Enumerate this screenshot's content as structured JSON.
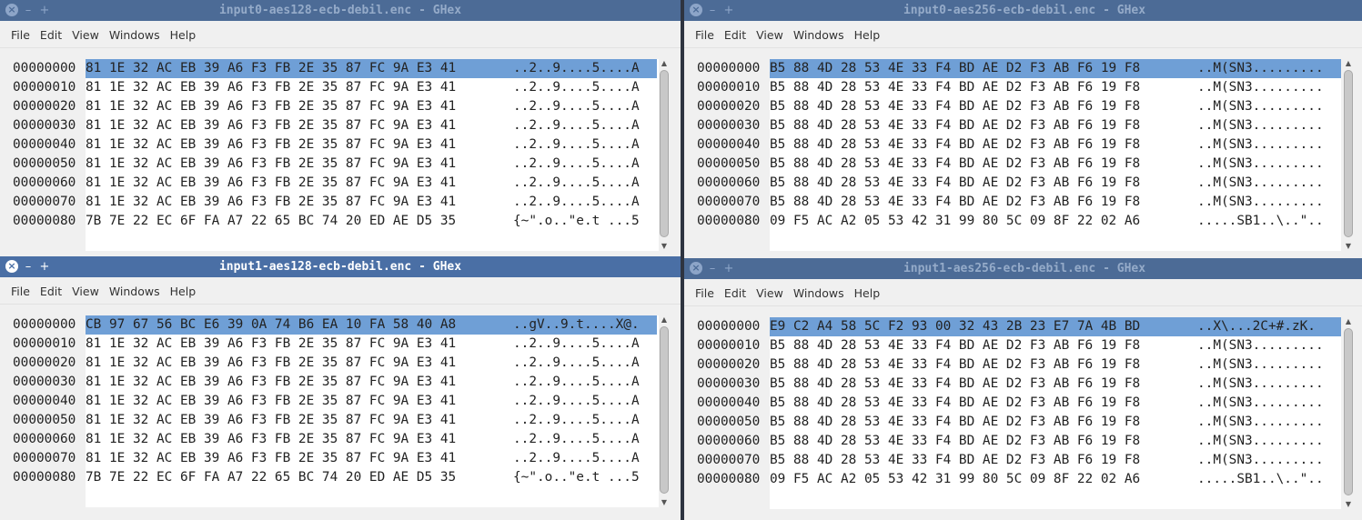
{
  "menus": [
    "File",
    "Edit",
    "View",
    "Windows",
    "Help"
  ],
  "controls": {
    "close": "×",
    "minimize": "–",
    "maximize": "+"
  },
  "scroll": {
    "up": "▲",
    "down": "▼"
  },
  "windows": [
    {
      "title": "input0-aes128-ecb-debil.enc - GHex",
      "active": false,
      "offsets": [
        "00000000",
        "00000010",
        "00000020",
        "00000030",
        "00000040",
        "00000050",
        "00000060",
        "00000070",
        "00000080"
      ],
      "hex": [
        "81 1E 32 AC EB 39 A6 F3 FB 2E 35 87 FC 9A E3 41",
        "81 1E 32 AC EB 39 A6 F3 FB 2E 35 87 FC 9A E3 41",
        "81 1E 32 AC EB 39 A6 F3 FB 2E 35 87 FC 9A E3 41",
        "81 1E 32 AC EB 39 A6 F3 FB 2E 35 87 FC 9A E3 41",
        "81 1E 32 AC EB 39 A6 F3 FB 2E 35 87 FC 9A E3 41",
        "81 1E 32 AC EB 39 A6 F3 FB 2E 35 87 FC 9A E3 41",
        "81 1E 32 AC EB 39 A6 F3 FB 2E 35 87 FC 9A E3 41",
        "81 1E 32 AC EB 39 A6 F3 FB 2E 35 87 FC 9A E3 41",
        "7B 7E 22 EC 6F FA A7 22 65 BC 74 20 ED AE D5 35"
      ],
      "ascii": [
        "..2..9....5....A",
        "..2..9....5....A",
        "..2..9....5....A",
        "..2..9....5....A",
        "..2..9....5....A",
        "..2..9....5....A",
        "..2..9....5....A",
        "..2..9....5....A",
        "{~\".o..\"e.t ...5"
      ]
    },
    {
      "title": "input0-aes256-ecb-debil.enc - GHex",
      "active": false,
      "offsets": [
        "00000000",
        "00000010",
        "00000020",
        "00000030",
        "00000040",
        "00000050",
        "00000060",
        "00000070",
        "00000080"
      ],
      "hex": [
        "B5 88 4D 28 53 4E 33 F4 BD AE D2 F3 AB F6 19 F8",
        "B5 88 4D 28 53 4E 33 F4 BD AE D2 F3 AB F6 19 F8",
        "B5 88 4D 28 53 4E 33 F4 BD AE D2 F3 AB F6 19 F8",
        "B5 88 4D 28 53 4E 33 F4 BD AE D2 F3 AB F6 19 F8",
        "B5 88 4D 28 53 4E 33 F4 BD AE D2 F3 AB F6 19 F8",
        "B5 88 4D 28 53 4E 33 F4 BD AE D2 F3 AB F6 19 F8",
        "B5 88 4D 28 53 4E 33 F4 BD AE D2 F3 AB F6 19 F8",
        "B5 88 4D 28 53 4E 33 F4 BD AE D2 F3 AB F6 19 F8",
        "09 F5 AC A2 05 53 42 31 99 80 5C 09 8F 22 02 A6"
      ],
      "ascii": [
        "..M(SN3.........",
        "..M(SN3.........",
        "..M(SN3.........",
        "..M(SN3.........",
        "..M(SN3.........",
        "..M(SN3.........",
        "..M(SN3.........",
        "..M(SN3.........",
        ".....SB1..\\..\".."
      ]
    },
    {
      "title": "input1-aes128-ecb-debil.enc - GHex",
      "active": true,
      "offsets": [
        "00000000",
        "00000010",
        "00000020",
        "00000030",
        "00000040",
        "00000050",
        "00000060",
        "00000070",
        "00000080"
      ],
      "hex": [
        "CB 97 67 56 BC E6 39 0A 74 B6 EA 10 FA 58 40 A8",
        "81 1E 32 AC EB 39 A6 F3 FB 2E 35 87 FC 9A E3 41",
        "81 1E 32 AC EB 39 A6 F3 FB 2E 35 87 FC 9A E3 41",
        "81 1E 32 AC EB 39 A6 F3 FB 2E 35 87 FC 9A E3 41",
        "81 1E 32 AC EB 39 A6 F3 FB 2E 35 87 FC 9A E3 41",
        "81 1E 32 AC EB 39 A6 F3 FB 2E 35 87 FC 9A E3 41",
        "81 1E 32 AC EB 39 A6 F3 FB 2E 35 87 FC 9A E3 41",
        "81 1E 32 AC EB 39 A6 F3 FB 2E 35 87 FC 9A E3 41",
        "7B 7E 22 EC 6F FA A7 22 65 BC 74 20 ED AE D5 35"
      ],
      "ascii": [
        "..gV..9.t....X@.",
        "..2..9....5....A",
        "..2..9....5....A",
        "..2..9....5....A",
        "..2..9....5....A",
        "..2..9....5....A",
        "..2..9....5....A",
        "..2..9....5....A",
        "{~\".o..\"e.t ...5"
      ]
    },
    {
      "title": "input1-aes256-ecb-debil.enc - GHex",
      "active": false,
      "offsets": [
        "00000000",
        "00000010",
        "00000020",
        "00000030",
        "00000040",
        "00000050",
        "00000060",
        "00000070",
        "00000080"
      ],
      "hex": [
        "E9 C2 A4 58 5C F2 93 00 32 43 2B 23 E7 7A 4B BD",
        "B5 88 4D 28 53 4E 33 F4 BD AE D2 F3 AB F6 19 F8",
        "B5 88 4D 28 53 4E 33 F4 BD AE D2 F3 AB F6 19 F8",
        "B5 88 4D 28 53 4E 33 F4 BD AE D2 F3 AB F6 19 F8",
        "B5 88 4D 28 53 4E 33 F4 BD AE D2 F3 AB F6 19 F8",
        "B5 88 4D 28 53 4E 33 F4 BD AE D2 F3 AB F6 19 F8",
        "B5 88 4D 28 53 4E 33 F4 BD AE D2 F3 AB F6 19 F8",
        "B5 88 4D 28 53 4E 33 F4 BD AE D2 F3 AB F6 19 F8",
        "09 F5 AC A2 05 53 42 31 99 80 5C 09 8F 22 02 A6"
      ],
      "ascii": [
        "..X\\...2C+#.zK.",
        "..M(SN3.........",
        "..M(SN3.........",
        "..M(SN3.........",
        "..M(SN3.........",
        "..M(SN3.........",
        "..M(SN3.........",
        "..M(SN3.........",
        ".....SB1..\\..\".."
      ]
    }
  ]
}
